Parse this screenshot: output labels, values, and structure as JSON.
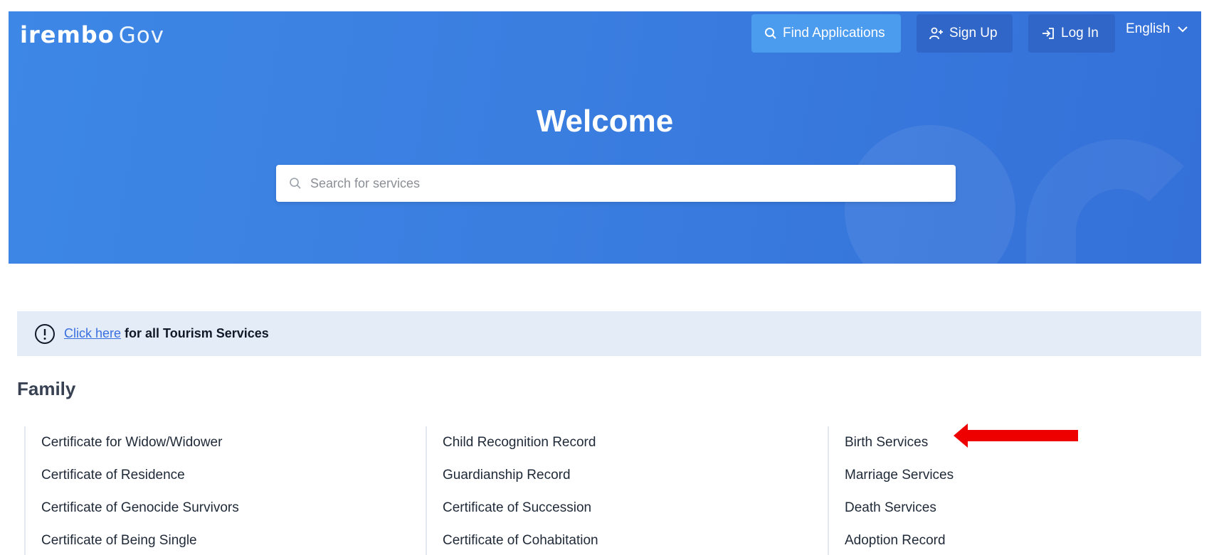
{
  "header": {
    "logo_word": "irembo",
    "logo_gov": "Gov",
    "find_label": "Find Applications",
    "signup_label": "Sign Up",
    "login_label": "Log In",
    "language": "English"
  },
  "hero": {
    "title": "Welcome",
    "search_placeholder": "Search for services"
  },
  "notice": {
    "link_text": "Click here",
    "rest_text": "for all Tourism Services"
  },
  "section": {
    "title": "Family",
    "columns": [
      [
        "Certificate for Widow/Widower",
        "Certificate of Residence",
        "Certificate of Genocide Survivors",
        "Certificate of Being Single"
      ],
      [
        "Child Recognition Record",
        "Guardianship Record",
        "Certificate of Succession",
        "Certificate of Cohabitation"
      ],
      [
        "Birth Services",
        "Marriage Services",
        "Death Services",
        "Adoption Record"
      ]
    ]
  },
  "colors": {
    "hero_blue": "#3a7ee0",
    "find_button": "#4b9bef",
    "nav_button": "#2f66c8",
    "notice_bg": "#e3ecf7",
    "link": "#3a6fe0",
    "annotation_arrow": "#ee0000"
  },
  "icons": {
    "find": "search-icon",
    "signup": "user-plus-icon",
    "login": "login-icon",
    "lang": "chevron-down-icon",
    "search": "search-icon",
    "notice": "info-circle-icon"
  }
}
